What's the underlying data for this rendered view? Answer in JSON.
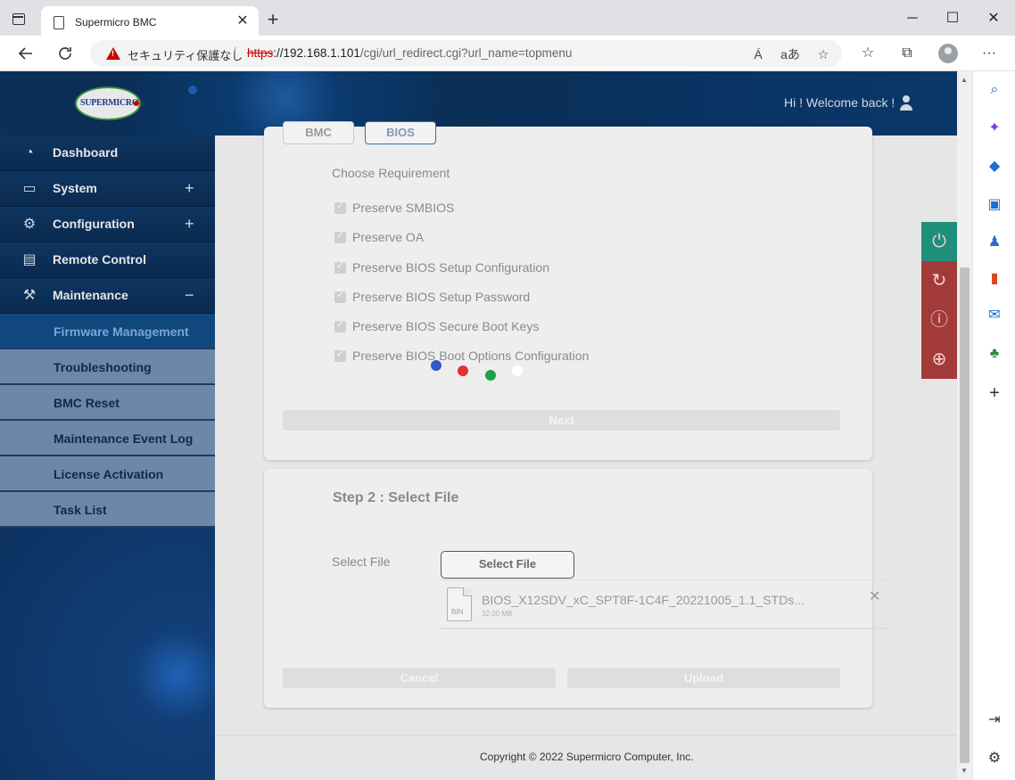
{
  "browser": {
    "tab_title": "Supermicro BMC",
    "tab_close": "✕",
    "new_tab": "+",
    "window": {
      "minimize": "─",
      "maximize": "☐",
      "close": "✕"
    },
    "security_text": "セキュリティ保護なし",
    "url_proto": "https",
    "url_host": "://192.168.1.101",
    "url_path": "/cgi/url_redirect.cgi?url_name=topmenu",
    "icons": [
      "back-icon",
      "refresh-icon",
      "read-aloud-icon",
      "translate-icon",
      "favorite-add-icon",
      "favorites-icon",
      "collections-icon",
      "profile-icon",
      "more-icon"
    ],
    "read_aloud": "Á",
    "translate": "aあ",
    "more": "···"
  },
  "header": {
    "logo_text": "SUPERMICRO",
    "welcome": "Hi ! Welcome back !"
  },
  "sidebar": {
    "items": [
      {
        "label": "Dashboard",
        "icon": "dashboard-icon",
        "toggle": ""
      },
      {
        "label": "System",
        "icon": "monitor-icon",
        "toggle": "+"
      },
      {
        "label": "Configuration",
        "icon": "gear-icon",
        "toggle": "+"
      },
      {
        "label": "Remote Control",
        "icon": "console-icon",
        "toggle": ""
      },
      {
        "label": "Maintenance",
        "icon": "wrench-icon",
        "toggle": "−"
      }
    ],
    "sub_items": [
      {
        "label": "Firmware Management",
        "active": true
      },
      {
        "label": "Troubleshooting",
        "active": false
      },
      {
        "label": "BMC Reset",
        "active": false
      },
      {
        "label": "Maintenance Event Log",
        "active": false
      },
      {
        "label": "License Activation",
        "active": false
      },
      {
        "label": "Task List",
        "active": false
      }
    ]
  },
  "step1": {
    "tabs": [
      "BMC",
      "BIOS"
    ],
    "selected_tab": "BIOS",
    "choose_label": "Choose Requirement",
    "options": [
      {
        "label": "Preserve SMBIOS",
        "checked": true
      },
      {
        "label": "Preserve OA",
        "checked": true
      },
      {
        "label": "Preserve BIOS Setup Configuration",
        "checked": true
      },
      {
        "label": "Preserve BIOS Setup Password",
        "checked": true
      },
      {
        "label": "Preserve BIOS Secure Boot Keys",
        "checked": true
      },
      {
        "label": "Preserve BIOS Boot Options Configuration",
        "checked": true
      }
    ],
    "loading_dot_colors": [
      "#3557c4",
      "#e53030",
      "#1ea04a",
      "#ffffff"
    ],
    "next_label": "Next"
  },
  "step2": {
    "title": "Step 2 : Select File",
    "select_file_label": "Select File",
    "select_file_button": "Select File",
    "file": {
      "type": "BIN",
      "name": "BIOS_X12SDV_xC_SPT8F-1C4F_20221005_1.1_STDs...",
      "size": "32.00 MB",
      "remove": "✕"
    },
    "cancel_label": "Cancel",
    "upload_label": "Upload"
  },
  "actions": [
    {
      "name": "power-icon",
      "color": "#1e8f7a",
      "glyph": "⏻"
    },
    {
      "name": "refresh-icon",
      "color": "#a33a3a",
      "glyph": "↻"
    },
    {
      "name": "info-icon",
      "color": "#a33a3a",
      "glyph": "ⓘ"
    },
    {
      "name": "globe-icon",
      "color": "#a33a3a",
      "glyph": "⊕"
    }
  ],
  "footer": {
    "copyright": "Copyright © 2022 Supermicro Computer, Inc."
  },
  "edge_sidebar": {
    "icons": [
      "search-icon",
      "copilot-icon",
      "shopping-icon",
      "tools-icon",
      "games-icon",
      "office-icon",
      "outlook-icon",
      "tree-icon",
      "add-icon",
      "split-screen-icon",
      "settings-icon"
    ],
    "add": "+"
  }
}
